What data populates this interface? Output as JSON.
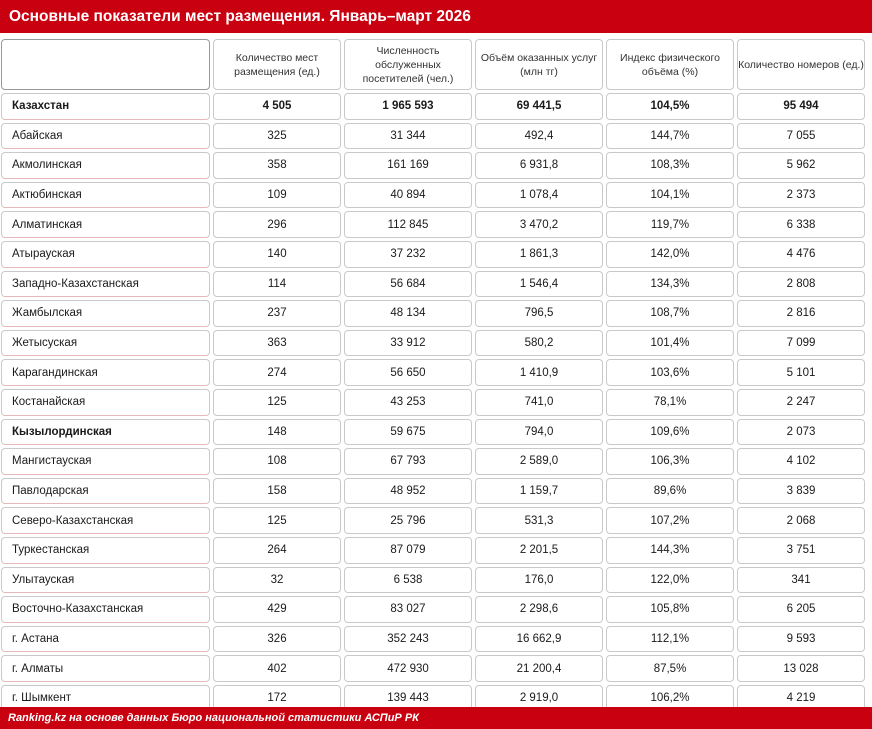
{
  "title": "Основные показатели мест размещения. Январь–март 2026",
  "source": "Ranking.kz на основе данных Бюро национальной статистики АСПиР РК",
  "chart_data": {
    "type": "table",
    "columns": [
      "",
      "Количество мест размещения (ед.)",
      "Численность обслуженных посетителей (чел.)",
      "Объём оказанных услуг (млн тг)",
      "Индекс физического объёма (%)",
      "Количество номеров (ед.)"
    ],
    "rows": [
      {
        "name": "Казахстан",
        "values": [
          "4 505",
          "1 965 593",
          "69 441,5",
          "104,5%",
          "95 494"
        ]
      },
      {
        "name": "Абайская",
        "values": [
          "325",
          "31 344",
          "492,4",
          "144,7%",
          "7 055"
        ]
      },
      {
        "name": "Акмолинская",
        "values": [
          "358",
          "161 169",
          "6 931,8",
          "108,3%",
          "5 962"
        ]
      },
      {
        "name": "Актюбинская",
        "values": [
          "109",
          "40 894",
          "1 078,4",
          "104,1%",
          "2 373"
        ]
      },
      {
        "name": "Алматинская",
        "values": [
          "296",
          "112 845",
          "3 470,2",
          "119,7%",
          "6 338"
        ]
      },
      {
        "name": "Атырауская",
        "values": [
          "140",
          "37 232",
          "1 861,3",
          "142,0%",
          "4 476"
        ]
      },
      {
        "name": "Западно-Казахстанская",
        "values": [
          "114",
          "56 684",
          "1 546,4",
          "134,3%",
          "2 808"
        ]
      },
      {
        "name": "Жамбылская",
        "values": [
          "237",
          "48 134",
          "796,5",
          "108,7%",
          "2 816"
        ]
      },
      {
        "name": "Жетысуская",
        "values": [
          "363",
          "33 912",
          "580,2",
          "101,4%",
          "7 099"
        ]
      },
      {
        "name": "Карагандинская",
        "values": [
          "274",
          "56 650",
          "1 410,9",
          "103,6%",
          "5 101"
        ]
      },
      {
        "name": "Костанайская",
        "values": [
          "125",
          "43 253",
          "741,0",
          "78,1%",
          "2 247"
        ]
      },
      {
        "name": "Кызылординская",
        "values": [
          "148",
          "59 675",
          "794,0",
          "109,6%",
          "2 073"
        ]
      },
      {
        "name": "Мангистауская",
        "values": [
          "108",
          "67 793",
          "2 589,0",
          "106,3%",
          "4 102"
        ]
      },
      {
        "name": "Павлодарская",
        "values": [
          "158",
          "48 952",
          "1 159,7",
          "89,6%",
          "3 839"
        ]
      },
      {
        "name": "Северо-Казахстанская",
        "values": [
          "125",
          "25 796",
          "531,3",
          "107,2%",
          "2 068"
        ]
      },
      {
        "name": "Туркестанская",
        "values": [
          "264",
          "87 079",
          "2 201,5",
          "144,3%",
          "3 751"
        ]
      },
      {
        "name": "Улытауская",
        "values": [
          "32",
          "6 538",
          "176,0",
          "122,0%",
          "341"
        ]
      },
      {
        "name": "Восточно-Казахстанская",
        "values": [
          "429",
          "83 027",
          "2 298,6",
          "105,8%",
          "6 205"
        ]
      },
      {
        "name": "г. Астана",
        "values": [
          "326",
          "352 243",
          "16 662,9",
          "112,1%",
          "9 593"
        ]
      },
      {
        "name": "г. Алматы",
        "values": [
          "402",
          "472 930",
          "21 200,4",
          "87,5%",
          "13 028"
        ]
      },
      {
        "name": "г. Шымкент",
        "values": [
          "172",
          "139 443",
          "2 919,0",
          "106,2%",
          "4 219"
        ]
      }
    ]
  }
}
